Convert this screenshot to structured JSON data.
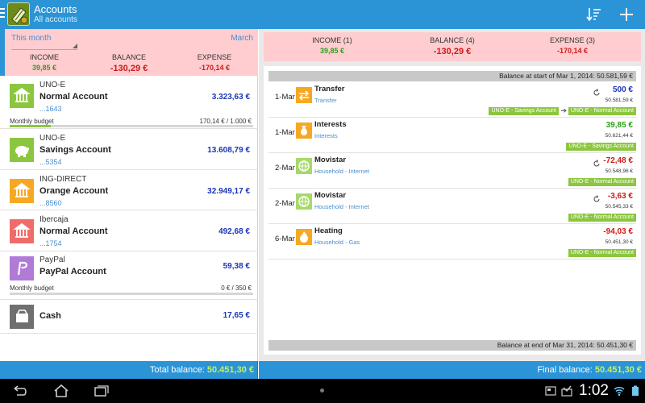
{
  "app": {
    "title": "Accounts",
    "subtitle": "All accounts"
  },
  "period": {
    "selector": "This month",
    "month": "March",
    "income_label": "INCOME",
    "income": "39,85 €",
    "balance_label": "BALANCE",
    "balance": "-130,29 €",
    "expense_label": "EXPENSE",
    "expense": "-170,14 €"
  },
  "accounts": [
    {
      "bank": "UNO-E",
      "name": "Normal Account",
      "number": "...1643",
      "balance": "3.323,63 €",
      "budget_label": "Monthly budget",
      "budget_value": "170,14 € / 1.000 €",
      "budget_fraction": 0.17,
      "color": "#8cc63f",
      "icon": "bank-icon"
    },
    {
      "bank": "UNO-E",
      "name": "Savings Account",
      "number": "...5354",
      "balance": "13.608,79 €",
      "color": "#8cc63f",
      "icon": "piggy-bank-icon"
    },
    {
      "bank": "ING-DIRECT",
      "name": "Orange Account",
      "number": "...8560",
      "balance": "32.949,17 €",
      "color": "#f7a823",
      "icon": "bank-icon"
    },
    {
      "bank": "Ibercaja",
      "name": "Normal Account",
      "number": "...1754",
      "balance": "492,68 €",
      "color": "#f26b6b",
      "icon": "bank-icon"
    },
    {
      "bank": "PayPal",
      "name": "PayPal Account",
      "number": "",
      "balance": "59,38 €",
      "budget_label": "Monthly budget",
      "budget_value": "0 € / 350 €",
      "budget_fraction": 0.0,
      "color": "#b07ad6",
      "icon": "paypal-icon"
    },
    {
      "bank": "",
      "name": "Cash",
      "number": "",
      "balance": "17,65 €",
      "color": "#6f6f6f",
      "icon": "wallet-icon"
    }
  ],
  "total": {
    "label": "Total balance:",
    "value": "50.451,30 €"
  },
  "summary": {
    "income_label": "INCOME (1)",
    "income": "39,85 €",
    "balance_label": "BALANCE (4)",
    "balance": "-130,29 €",
    "expense_label": "EXPENSE (3)",
    "expense": "-170,14 €"
  },
  "start_balance": "Balance at start of Mar 1, 2014: 50.581,59 €",
  "end_balance": "Balance at end of Mar 31, 2014: 50.451,30 €",
  "transactions": [
    {
      "date": "1-Mar",
      "title": "Transfer",
      "category": "Transfer",
      "amount": "500 €",
      "running": "50.581,59 €",
      "from": "UNO-E - Savings Account",
      "to": "UNO-E - Normal Account",
      "amount_color": "#1b35b8",
      "icon_color": "#f7a823",
      "icon": "transfer-icon",
      "recurring": true
    },
    {
      "date": "1-Mar",
      "title": "Interests",
      "category": "Interests",
      "amount": "39,85 €",
      "running": "50.621,44 €",
      "to": "UNO-E - Savings Account",
      "amount_color": "#2e9e1e",
      "icon_color": "#f7a823",
      "icon": "money-bag-icon",
      "recurring": false
    },
    {
      "date": "2-Mar",
      "title": "Movistar",
      "category": "Household - Internet",
      "amount": "-72,48 €",
      "running": "50.548,96 €",
      "to": "UNO-E - Normal Account",
      "amount_color": "#d01818",
      "icon_color": "#a8d86a",
      "icon": "globe-icon",
      "recurring": true
    },
    {
      "date": "2-Mar",
      "title": "Movistar",
      "category": "Household - Internet",
      "amount": "-3,63 €",
      "running": "50.545,33 €",
      "to": "UNO-E - Normal Account",
      "amount_color": "#d01818",
      "icon_color": "#a8d86a",
      "icon": "globe-icon",
      "recurring": true
    },
    {
      "date": "6-Mar",
      "title": "Heating",
      "category": "Household - Gas",
      "amount": "-94,03 €",
      "running": "50.451,30 €",
      "to": "UNO-E - Normal Account",
      "amount_color": "#d01818",
      "icon_color": "#f7a823",
      "icon": "flame-icon",
      "recurring": false
    }
  ],
  "final": {
    "label": "Final balance:",
    "value": "50.451,30 €"
  },
  "status": {
    "time": "1:02"
  },
  "colors": {
    "accent": "#2a94d6",
    "summary_bg": "#ffcdd0",
    "income": "#2e9e1e",
    "expense": "#d01818",
    "account_balance": "#1b35b8",
    "tag": "#8cc63f"
  }
}
